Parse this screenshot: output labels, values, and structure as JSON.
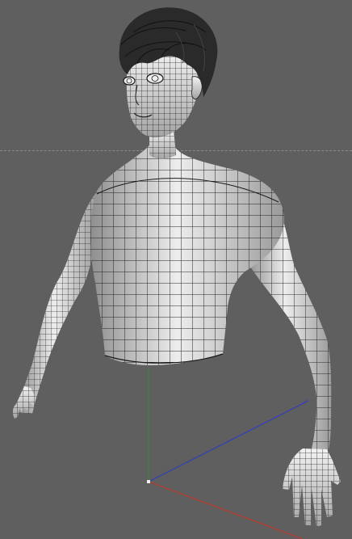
{
  "viewport": {
    "background_color": "#5f5f5f",
    "horizon_color": "#8a8a8a"
  },
  "model": {
    "shading": "wireframe-over-smooth",
    "surface_color": "#c9c9c9",
    "wire_color": "#1a1a1a",
    "hair_color": "#2a2a2a"
  },
  "gizmo": {
    "x_axis_color": "#c0392b",
    "y_axis_color": "#2e8b3a",
    "z_axis_color": "#2f3fb8",
    "origin_color": "#f0f0f0"
  }
}
